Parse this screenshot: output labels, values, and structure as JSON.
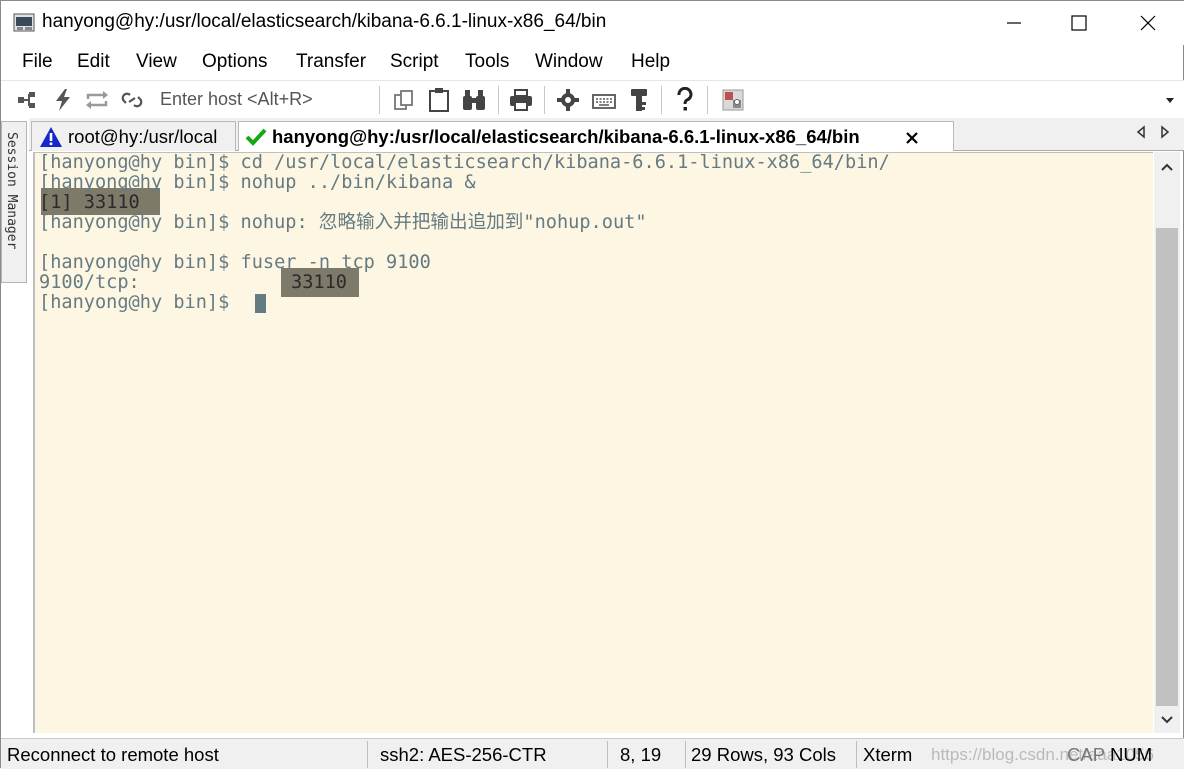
{
  "window": {
    "title": "hanyong@hy:/usr/local/elasticsearch/kibana-6.6.1-linux-x86_64/bin"
  },
  "menu": [
    "File",
    "Edit",
    "View",
    "Options",
    "Transfer",
    "Script",
    "Tools",
    "Window",
    "Help"
  ],
  "toolbar": {
    "host_placeholder": "Enter host <Alt+R>"
  },
  "session_manager": {
    "label": "Session Manager"
  },
  "tabs": [
    {
      "label": "root@hy:/usr/local",
      "status": "warning",
      "status_color": "#1428c8"
    },
    {
      "label": "hanyong@hy:/usr/local/elasticsearch/kibana-6.6.1-linux-x86_64/bin",
      "status": "connected",
      "status_color": "#16a816",
      "active": true
    }
  ],
  "terminal": {
    "colors": {
      "background": "#fdf6e3",
      "foreground": "#657b83",
      "highlight": "#7d7a6a"
    },
    "lines": [
      "[hanyong@hy bin]$ cd /usr/local/elasticsearch/kibana-6.6.1-linux-x86_64/bin/",
      "[hanyong@hy bin]$ nohup ../bin/kibana &",
      "[1] 33110",
      "[hanyong@hy bin]$ nohup: 忽略输入并把输出追加到\"nohup.out\"",
      "",
      "[hanyong@hy bin]$ fuser -n tcp 9100",
      "9100/tcp:",
      "[hanyong@hy bin]$ "
    ],
    "highlights": [
      "[1] 33110",
      "33110"
    ]
  },
  "statusbar": {
    "message": "Reconnect to remote host",
    "protocol": "ssh2: AES-256-CTR",
    "cursor_pos": "8,  19",
    "dimensions": "29 Rows, 93 Cols",
    "terminal_type": "Xterm",
    "caps": "CAP",
    "num": "NUM",
    "watermark": "https://blog.csdn.net/aaa1056"
  }
}
